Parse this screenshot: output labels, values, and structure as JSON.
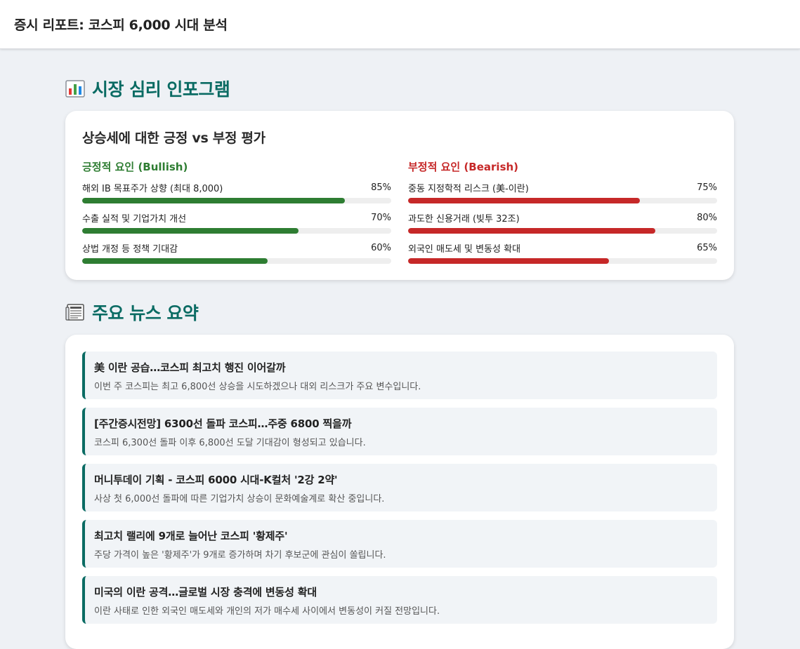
{
  "header": {
    "title": "증시 리포트: 코스피 6,000 시대 분석"
  },
  "infographic": {
    "section_title": "시장 심리 인포그램",
    "section_icon": "bar-chart-icon",
    "card_heading": "상승세에 대한 긍정 vs 부정 평가",
    "bullish": {
      "title": "긍정적 요인 (Bullish)",
      "color": "#2e7d32",
      "factors": [
        {
          "label": "해외 IB 목표주가 상향 (최대 8,000)",
          "value": 85,
          "value_text": "85%"
        },
        {
          "label": "수출 실적 및 기업가치 개선",
          "value": 70,
          "value_text": "70%"
        },
        {
          "label": "상법 개정 등 정책 기대감",
          "value": 60,
          "value_text": "60%"
        }
      ]
    },
    "bearish": {
      "title": "부정적 요인 (Bearish)",
      "color": "#c62828",
      "factors": [
        {
          "label": "중동 지정학적 리스크 (美-이란)",
          "value": 75,
          "value_text": "75%"
        },
        {
          "label": "과도한 신용거래 (빚투 32조)",
          "value": 80,
          "value_text": "80%"
        },
        {
          "label": "외국인 매도세 및 변동성 확대",
          "value": 65,
          "value_text": "65%"
        }
      ]
    }
  },
  "news": {
    "section_title": "주요 뉴스 요약",
    "section_icon": "newspaper-icon",
    "accent": "#0a6b63",
    "items": [
      {
        "title": "美 이란 공습…코스피 최고치 행진 이어갈까",
        "desc": "이번 주 코스피는 최고 6,800선 상승을 시도하겠으나 대외 리스크가 주요 변수입니다."
      },
      {
        "title": "[주간증시전망] 6300선 돌파 코스피…주중 6800 찍을까",
        "desc": "코스피 6,300선 돌파 이후 6,800선 도달 기대감이 형성되고 있습니다."
      },
      {
        "title": "머니투데이 기획 - 코스피 6000 시대-K컬처 '2강 2약'",
        "desc": "사상 첫 6,000선 돌파에 따른 기업가치 상승이 문화예술계로 확산 중입니다."
      },
      {
        "title": "최고치 랠리에 9개로 늘어난 코스피 '황제주'",
        "desc": "주당 가격이 높은 '황제주'가 9개로 증가하며 차기 후보군에 관심이 쏠립니다."
      },
      {
        "title": "미국의 이란 공격…글로벌 시장 충격에 변동성 확대",
        "desc": "이란 사태로 인한 외국인 매도세와 개인의 저가 매수세 사이에서 변동성이 커질 전망입니다."
      }
    ]
  }
}
